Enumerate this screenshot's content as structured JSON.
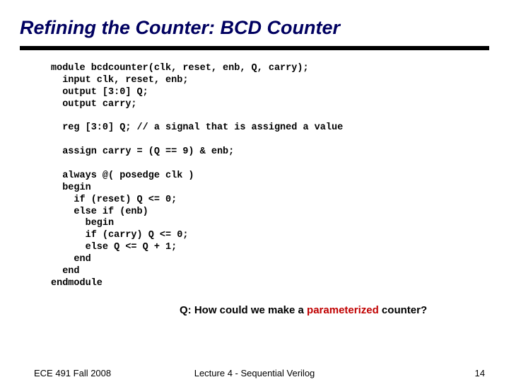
{
  "title": "Refining the Counter: BCD Counter",
  "code": "module bcdcounter(clk, reset, enb, Q, carry);\n  input clk, reset, enb;\n  output [3:0] Q;\n  output carry;\n\n  reg [3:0] Q; // a signal that is assigned a value\n\n  assign carry = (Q == 9) & enb;\n\n  always @( posedge clk )\n  begin\n    if (reset) Q <= 0;\n    else if (enb)\n      begin\n      if (carry) Q <= 0;\n      else Q <= Q + 1;\n    end\n  end\nendmodule",
  "question_prefix": "Q: How could we make a ",
  "question_highlight": "parameterized",
  "question_suffix": " counter?",
  "footer": {
    "left": "ECE 491 Fall 2008",
    "center": "Lecture 4 - Sequential Verilog",
    "right": "14"
  }
}
